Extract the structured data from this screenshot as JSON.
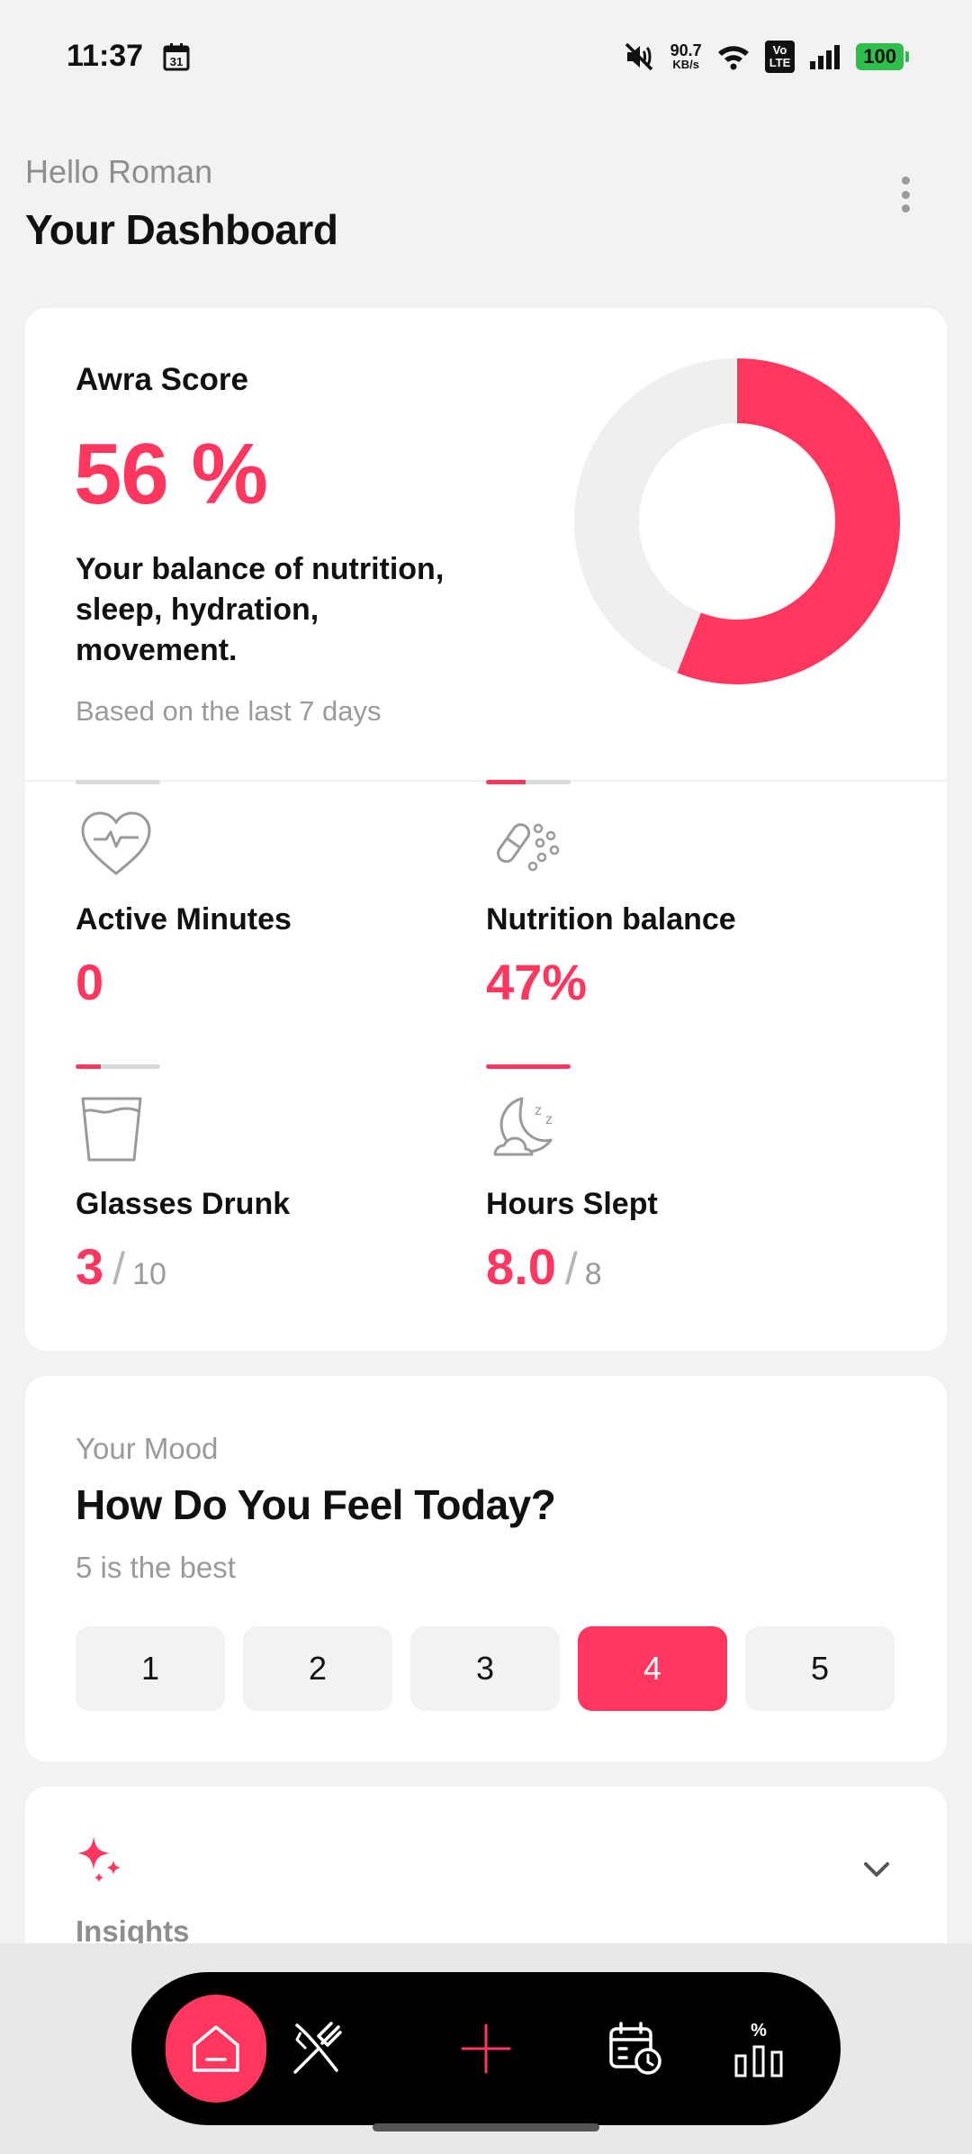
{
  "status_bar": {
    "time": "11:37",
    "calendar_day": "31",
    "net_speed_value": "90.7",
    "net_speed_unit": "KB/s",
    "volte_top": "Vo",
    "volte_bottom": "LTE",
    "battery": "100"
  },
  "header": {
    "greeting": "Hello Roman",
    "title": "Your Dashboard"
  },
  "score": {
    "label": "Awra Score",
    "value": "56 %",
    "percent": 56,
    "description": "Your balance of nutrition, sleep, hydration, movement.",
    "note": "Based on the last 7 days"
  },
  "metrics": [
    {
      "label": "Active Minutes",
      "value": "0",
      "total": "",
      "progress": 0,
      "icon": "heart-pulse-icon"
    },
    {
      "label": "Nutrition balance",
      "value": "47%",
      "total": "",
      "progress": 47,
      "icon": "pills-icon"
    },
    {
      "label": "Glasses Drunk",
      "value": "3",
      "total": "10",
      "progress": 30,
      "icon": "glass-icon"
    },
    {
      "label": "Hours Slept",
      "value": "8.0",
      "total": "8",
      "progress": 100,
      "icon": "moon-sleep-icon"
    }
  ],
  "mood": {
    "subtitle": "Your Mood",
    "title": "How Do You Feel Today?",
    "hint": "5 is the best",
    "options": [
      "1",
      "2",
      "3",
      "4",
      "5"
    ],
    "selected": "4"
  },
  "insights": {
    "title": "Insights",
    "icon": "sparkle-icon"
  },
  "nav": {
    "items": [
      "home-icon",
      "fork-knife-icon",
      "plus-icon",
      "calendar-clock-icon",
      "stats-percent-icon"
    ],
    "active": "home-icon"
  },
  "colors": {
    "accent": "#FF375F",
    "track": "#EFEFEF"
  }
}
